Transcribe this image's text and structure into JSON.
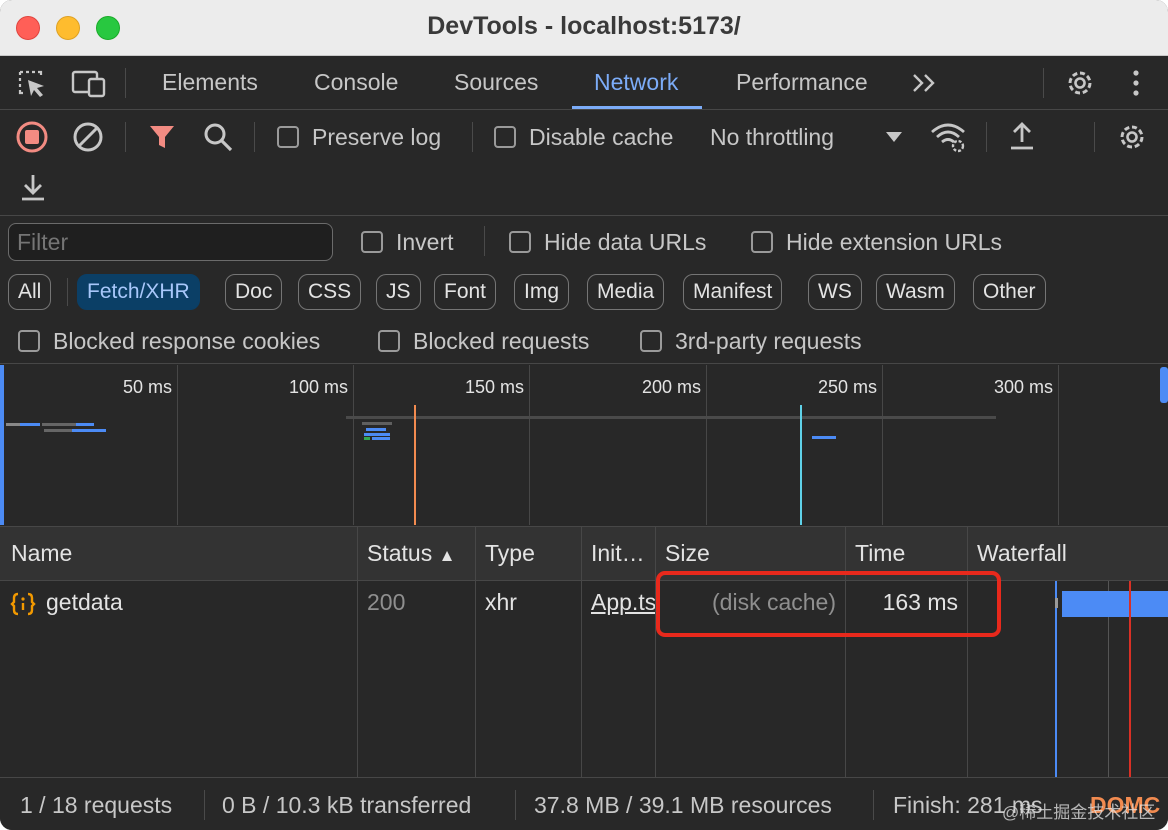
{
  "window": {
    "title": "DevTools - localhost:5173/"
  },
  "tabs": {
    "items": [
      "Elements",
      "Console",
      "Sources",
      "Network",
      "Performance"
    ],
    "active": "Network",
    "more": "»"
  },
  "toolbar": {
    "preserve_log": "Preserve log",
    "disable_cache": "Disable cache",
    "throttling": "No throttling"
  },
  "filters": {
    "placeholder": "Filter",
    "invert": "Invert",
    "hide_data_urls": "Hide data URLs",
    "hide_extension_urls": "Hide extension URLs",
    "types": [
      "All",
      "Fetch/XHR",
      "Doc",
      "CSS",
      "JS",
      "Font",
      "Img",
      "Media",
      "Manifest",
      "WS",
      "Wasm",
      "Other"
    ],
    "active_type": "Fetch/XHR",
    "blocked_response_cookies": "Blocked response cookies",
    "blocked_requests": "Blocked requests",
    "third_party": "3rd-party requests"
  },
  "overview": {
    "ticks": [
      "50 ms",
      "100 ms",
      "150 ms",
      "200 ms",
      "250 ms",
      "300 ms"
    ]
  },
  "table": {
    "columns": [
      "Name",
      "Status",
      "Type",
      "Init…",
      "Size",
      "Time",
      "Waterfall"
    ],
    "sort_indicator": "▲",
    "rows": [
      {
        "name": "getdata",
        "status": "200",
        "type": "xhr",
        "initiator": "App.tsx",
        "size": "(disk cache)",
        "time": "163 ms"
      }
    ]
  },
  "status": {
    "requests": "1 / 18 requests",
    "transferred": "0 B / 10.3 kB transferred",
    "resources": "37.8 MB / 39.1 MB resources",
    "finish": "Finish: 281 ms",
    "domcontent": "DOMC"
  },
  "watermark": "@稀土掘金技术社区",
  "colors": {
    "accent": "#7cacf8",
    "highlight": "#e8291c",
    "record": "#f28b82",
    "filter_icon": "#f28b82",
    "xhr_icon": "#f29900"
  }
}
